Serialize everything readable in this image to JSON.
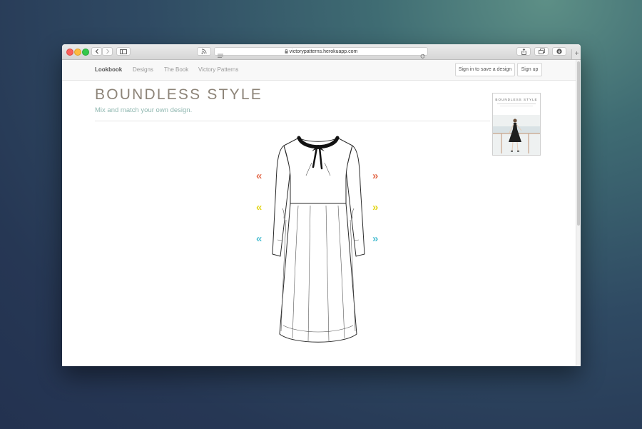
{
  "browser": {
    "url": "victorypatterns.herokuapp.com",
    "new_tab_symbol": "+"
  },
  "nav": {
    "items": [
      "Lookbook",
      "Designs",
      "The Book",
      "Victory Patterns"
    ],
    "sign_in_label": "Sign in to save a design",
    "sign_up_label": "Sign up"
  },
  "hero": {
    "title": "BOUNDLESS STYLE",
    "subtitle": "Mix and match your own design."
  },
  "book": {
    "title": "BOUNDLESS STYLE"
  },
  "arrows": {
    "left_symbol": "«",
    "right_symbol": "»",
    "rows": [
      {
        "part": "bodice",
        "color": "#e46b4c"
      },
      {
        "part": "sleeve",
        "color": "#e3d61c"
      },
      {
        "part": "skirt",
        "color": "#4fbfd2"
      }
    ]
  },
  "colors": {
    "title": "#8d8478",
    "subtitle": "#8fb7b0",
    "accent_bodice": "#e46b4c",
    "accent_sleeve": "#e3d61c",
    "accent_skirt": "#4fbfd2"
  }
}
